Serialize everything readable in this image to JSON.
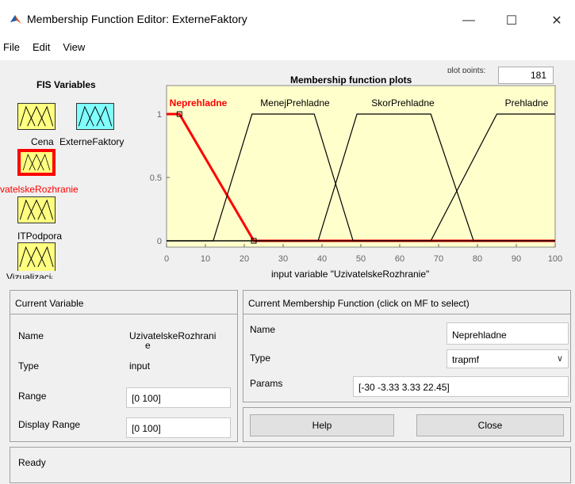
{
  "window": {
    "title": "Membership Function Editor: ExterneFaktory",
    "minimize": "—",
    "maximize": "☐",
    "close": "✕"
  },
  "menu": [
    "File",
    "Edit",
    "View"
  ],
  "fis": {
    "title": "FIS Variables",
    "variables": [
      "Cena",
      "ExterneFaktory",
      "vatelskeRozhranie",
      "ITPodpora",
      "Vizualizacia"
    ]
  },
  "plot": {
    "title": "Membership function plots",
    "plot_points_label": "plot points:",
    "plot_points_value": "181",
    "xlabel": "input variable \"UzivatelskeRozhranie\"",
    "colors": {
      "selected": "#ff0000",
      "normal": "#000000",
      "background": "#ffffcc"
    }
  },
  "chart_data": {
    "type": "line",
    "xlabel": "input variable \"UzivatelskeRozhranie\"",
    "xlim": [
      0,
      100
    ],
    "ylim": [
      0,
      1
    ],
    "x_ticks": [
      "0",
      "10",
      "20",
      "30",
      "40",
      "50",
      "60",
      "70",
      "80",
      "90",
      "100"
    ],
    "y_ticks": [
      "0",
      "0.5",
      "1"
    ],
    "series": [
      {
        "name": "Neprehladne",
        "params": [
          -30,
          -3.33,
          3.33,
          22.45
        ],
        "selected": true
      },
      {
        "name": "MenejPrehladne",
        "params": [
          12,
          22,
          38,
          48
        ],
        "selected": false
      },
      {
        "name": "SkorPrehladne",
        "params": [
          39,
          49,
          68,
          79
        ],
        "selected": false
      },
      {
        "name": "Prehladne",
        "params": [
          68,
          85,
          100,
          130
        ],
        "selected": false
      }
    ]
  },
  "current_variable": {
    "header": "Current Variable",
    "name_label": "Name",
    "name_value_line1": "UzivatelskeRozhrani",
    "name_value_line2": "e",
    "type_label": "Type",
    "type_value": "input",
    "range_label": "Range",
    "range_value": "[0 100]",
    "display_range_label": "Display Range",
    "display_range_value": "[0 100]"
  },
  "current_mf": {
    "header": "Current Membership Function (click on MF to select)",
    "name_label": "Name",
    "name_value": "Neprehladne",
    "type_label": "Type",
    "type_value": "trapmf",
    "params_label": "Params",
    "params_value": "[-30 -3.33 3.33 22.45]"
  },
  "buttons": {
    "help": "Help",
    "close": "Close"
  },
  "status": "Ready"
}
